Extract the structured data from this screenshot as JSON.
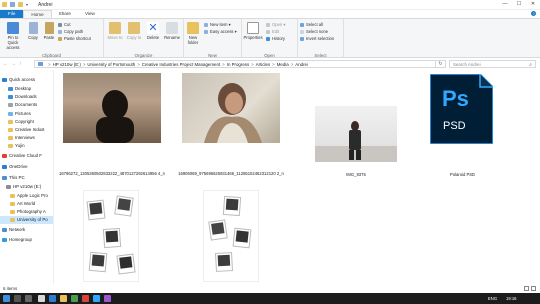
{
  "window": {
    "title": "Andrei"
  },
  "window_controls": {
    "minimize": "—",
    "maximize": "☐",
    "close": "✕"
  },
  "tabs": [
    {
      "label": "File"
    },
    {
      "label": "Home"
    },
    {
      "label": "Share"
    },
    {
      "label": "View"
    }
  ],
  "help_icon": "?",
  "ribbon": {
    "clipboard": {
      "pin_label": "Pin to Quick access",
      "copy_label": "Copy",
      "paste_label": "Paste",
      "cut_label": "Cut",
      "copy_path_label": "Copy path",
      "paste_shortcut_label": "Paste shortcut",
      "group_label": "Clipboard"
    },
    "organize": {
      "move_to_label": "Move to",
      "copy_to_label": "Copy to",
      "delete_label": "Delete",
      "rename_label": "Rename",
      "group_label": "Organize"
    },
    "new": {
      "new_folder_label": "New folder",
      "new_item_label": "New item ▾",
      "easy_access_label": "Easy access ▾",
      "group_label": "New"
    },
    "open": {
      "properties_label": "Properties",
      "open_label": "Open ▾",
      "edit_label": "Edit",
      "history_label": "History",
      "group_label": "Open"
    },
    "select": {
      "select_all_label": "Select all",
      "select_none_label": "Select none",
      "invert_selection_label": "Invert selection",
      "group_label": "Select"
    }
  },
  "address": {
    "crumbs": [
      "HP v210w (E:)",
      "University of Portsmouth",
      "Creative Industries Project Management",
      "In Progress",
      "Articles",
      "Media",
      "Andrei"
    ],
    "separator": ">",
    "search_placeholder": "Search Andrei"
  },
  "nav_buttons": {
    "back": "←",
    "forward": "→",
    "up": "↑",
    "refresh": "↻",
    "search": "⌕"
  },
  "navpane": {
    "items": [
      {
        "label": "Quick access",
        "icon": "star-icon",
        "color": "#2a7fd4"
      },
      {
        "label": "Desktop",
        "icon": "desktop-icon",
        "color": "#3b8de0"
      },
      {
        "label": "Downloads",
        "icon": "download-icon",
        "color": "#3b8de0"
      },
      {
        "label": "Documents",
        "icon": "document-icon",
        "color": "#9aa4b0"
      },
      {
        "label": "Pictures",
        "icon": "pictures-icon",
        "color": "#6fb1e8"
      },
      {
        "label": "Copyright",
        "icon": "folder-icon",
        "color": "#e8c25a"
      },
      {
        "label": "Creative Indust",
        "icon": "folder-icon",
        "color": "#e8c25a"
      },
      {
        "label": "Interviews",
        "icon": "folder-icon",
        "color": "#e8c25a"
      },
      {
        "label": "Yujin",
        "icon": "folder-icon",
        "color": "#e8c25a"
      },
      {
        "label": "Creative Cloud F",
        "icon": "creative-cloud-icon",
        "color": "#e0413a"
      },
      {
        "label": "OneDrive",
        "icon": "cloud-icon",
        "color": "#2a7fd4"
      },
      {
        "label": "This PC",
        "icon": "pc-icon",
        "color": "#4f8fd0"
      },
      {
        "label": "HP v210w (E:)",
        "icon": "drive-icon",
        "color": "#8d8d8d"
      },
      {
        "label": "Apple Logic Pro",
        "icon": "folder-icon",
        "color": "#e8c25a"
      },
      {
        "label": "Art World",
        "icon": "folder-icon",
        "color": "#e8c25a"
      },
      {
        "label": "Photography A",
        "icon": "folder-icon",
        "color": "#e8c25a"
      },
      {
        "label": "University of Po",
        "icon": "folder-icon",
        "color": "#e8c25a"
      },
      {
        "label": "Network",
        "icon": "network-icon",
        "color": "#4f8fd0"
      },
      {
        "label": "Homegroup",
        "icon": "homegroup-icon",
        "color": "#2a9fd8"
      }
    ]
  },
  "files": [
    {
      "name": "16796272_1305360502833222_4870127292614956 4_n",
      "kind": "silhouette-photo"
    },
    {
      "name": "16906069_975696625931466_11285102462312120 2_n",
      "kind": "portrait-photo"
    },
    {
      "name": "IMG_9375",
      "kind": "room-photo"
    },
    {
      "name": "Polaroid PSD",
      "kind": "photoshop-file",
      "icon_text": "Ps",
      "badge_text": "PSD"
    },
    {
      "name": "",
      "kind": "polaroid-collage"
    },
    {
      "name": "",
      "kind": "polaroid-collage"
    }
  ],
  "statusbar": {
    "count": "6 items"
  },
  "taskbar": {
    "lang": "ENG",
    "time": "19:16"
  },
  "colors": {
    "accent": "#1979ca",
    "selection": "#cce8ff",
    "ps_bg": "#001e36",
    "ps_fg": "#31a8ff"
  }
}
